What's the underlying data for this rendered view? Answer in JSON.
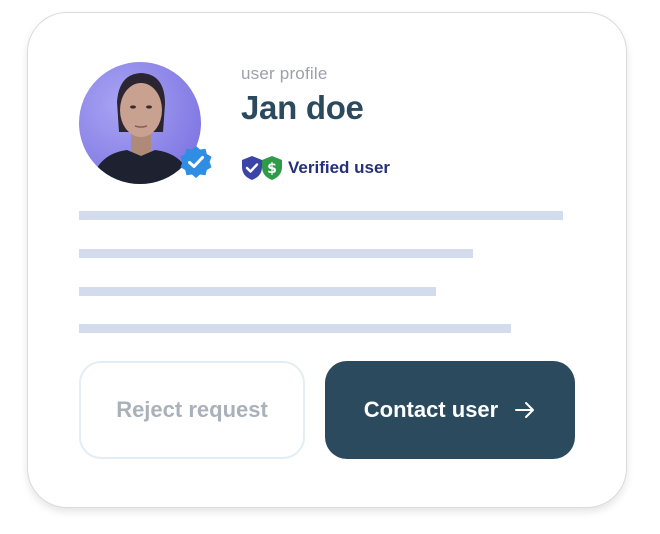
{
  "profile": {
    "subtitle": "user profile",
    "name": "Jan doe",
    "verified_label": "Verified user"
  },
  "actions": {
    "reject_label": "Reject request",
    "contact_label": "Contact user"
  },
  "icons": {
    "avatar_badge": "verified-badge-icon",
    "shield": "shield-check-icon",
    "dollar_shield": "shield-dollar-icon",
    "contact_arrow": "arrow-right-icon"
  },
  "colors": {
    "primary": "#2b4a5e",
    "verified_text": "#25307a",
    "badge_blue": "#2f8de4",
    "placeholder_line": "#d3dcec"
  }
}
